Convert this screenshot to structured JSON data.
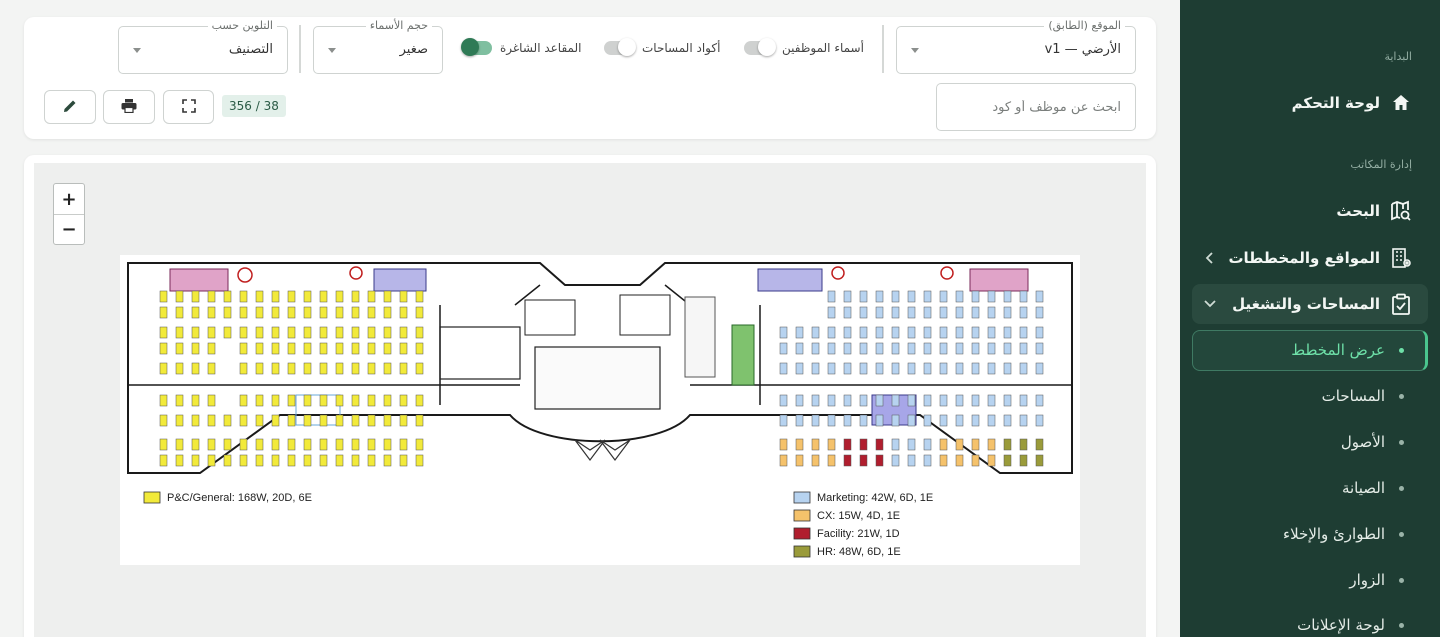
{
  "sidebar": {
    "section_start": "البداية",
    "dashboard": "لوحة التحكم",
    "section_office": "إدارة المكاتب",
    "search": "البحث",
    "sites": "المواقع والمخططات",
    "spaces_ops": "المساحات والتشغيل",
    "sub_items": [
      {
        "label": "عرض المخطط",
        "active": true
      },
      {
        "label": "المساحات"
      },
      {
        "label": "الأصول"
      },
      {
        "label": "الصيانة"
      },
      {
        "label": "الطوارئ والإخلاء"
      },
      {
        "label": "الزوار"
      },
      {
        "label": "لوحة الإعلانات"
      }
    ]
  },
  "toolbar": {
    "location_legend": "الموقع (الطابق)",
    "location_value": "الأرضي — v1",
    "toggle_names": "أسماء الموظفين",
    "toggle_codes": "أكواد المساحات",
    "toggle_vacant": "المقاعد الشاغرة",
    "name_size_legend": "حجم الأسماء",
    "name_size_value": "صغير",
    "color_by_legend": "التلوين حسب",
    "color_by_value": "التصنيف",
    "search_placeholder": "ابحث عن موظف أو كود",
    "count": "356 / 38"
  },
  "map": {
    "zoom_in": "+",
    "zoom_out": "−",
    "legend": [
      {
        "label": "P&C/General: 168W, 20D, 6E",
        "color": "#f2ea3a"
      },
      {
        "label": "Marketing: 42W, 6D, 1E",
        "color": "#b7d3f0"
      },
      {
        "label": "CX: 15W, 4D, 1E",
        "color": "#f5c26b"
      },
      {
        "label": "Facility: 21W, 1D",
        "color": "#b01e2e"
      },
      {
        "label": "HR: 48W, 6D, 1E",
        "color": "#9a9b3a"
      }
    ]
  },
  "colors": {
    "sidebar_bg": "#1e3d33",
    "accent": "#4ac58e",
    "switch_on": "#2f7a56"
  }
}
